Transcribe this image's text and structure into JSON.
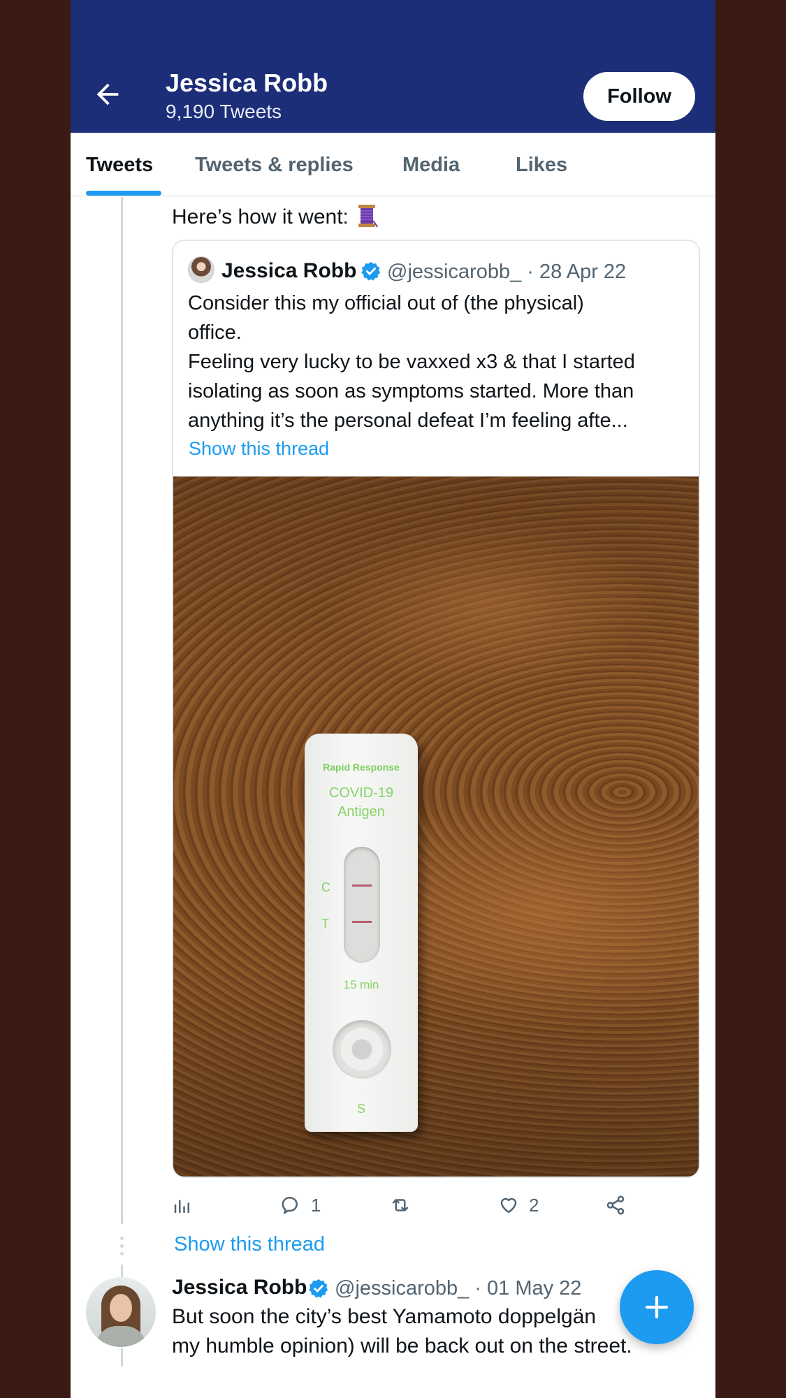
{
  "header": {
    "name": "Jessica Robb",
    "tweet_count": "9,190 Tweets",
    "follow_label": "Follow"
  },
  "tabs": [
    {
      "label": "Tweets",
      "active": true
    },
    {
      "label": "Tweets & replies",
      "active": false
    },
    {
      "label": "Media",
      "active": false
    },
    {
      "label": "Likes",
      "active": false
    }
  ],
  "tweet": {
    "text": "Here’s how it went:",
    "quote": {
      "name": "Jessica Robb",
      "handle_date": "@jessicarobb_ · 28 Apr 22",
      "body_lines": [
        "Consider this my official out of (the physical)",
        "office.",
        "Feeling very lucky to be vaxxed x3 & that I started",
        "isolating as soon as symptoms started. More than",
        "anything it’s the personal defeat I’m feeling afte..."
      ],
      "show_thread": "Show this thread",
      "photo_text": {
        "brand": "Rapid Response",
        "title": "COVID-19",
        "subtitle": "Antigen",
        "c": "C",
        "t": "T",
        "time": "15 min",
        "s": "S"
      }
    },
    "actions": {
      "replies": "1",
      "likes": "2"
    },
    "show_thread": "Show this thread"
  },
  "next_tweet": {
    "name": "Jessica Robb",
    "handle_date": "@jessicarobb_ · 01 May 22",
    "body_lines": [
      "But soon the city’s best Yamamoto doppelgän",
      "my humble opinion) will be back out on the street."
    ]
  },
  "colors": {
    "header_bg": "#1c2e78",
    "accent": "#1d9bf0",
    "text_primary": "#0f1419",
    "text_secondary": "#536471"
  }
}
